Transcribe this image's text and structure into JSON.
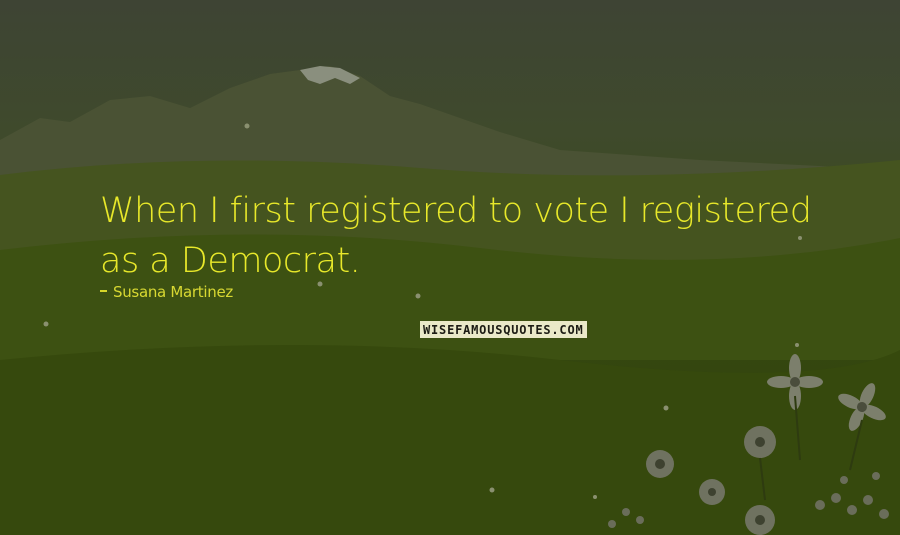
{
  "quote": {
    "text": "When I first registered to vote I registered as a Democrat.",
    "author": "Susana Martinez"
  },
  "watermark": {
    "text": "WISEFAMOUSQUOTES.COM",
    "background": "#eae9c8"
  },
  "colors": {
    "quote_text": "#e8e82a",
    "author_text": "#d8d832",
    "background_top": "#3e4434",
    "background_bottom": "#30420e"
  }
}
